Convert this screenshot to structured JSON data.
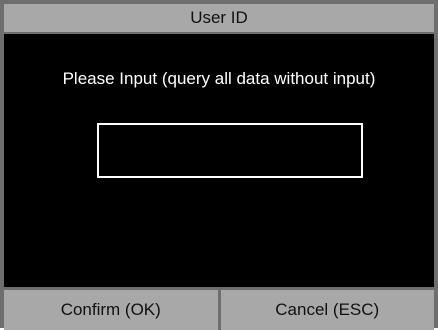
{
  "window": {
    "title": "User ID"
  },
  "form": {
    "prompt": "Please Input (query all data without input)",
    "input_value": ""
  },
  "buttons": {
    "confirm_label": "Confirm (OK)",
    "cancel_label": "Cancel (ESC)"
  },
  "colors": {
    "background": "#000000",
    "bar": "#a8a8a8",
    "border": "#6e6e6e",
    "text_light": "#ffffff",
    "text_dark": "#111111"
  }
}
